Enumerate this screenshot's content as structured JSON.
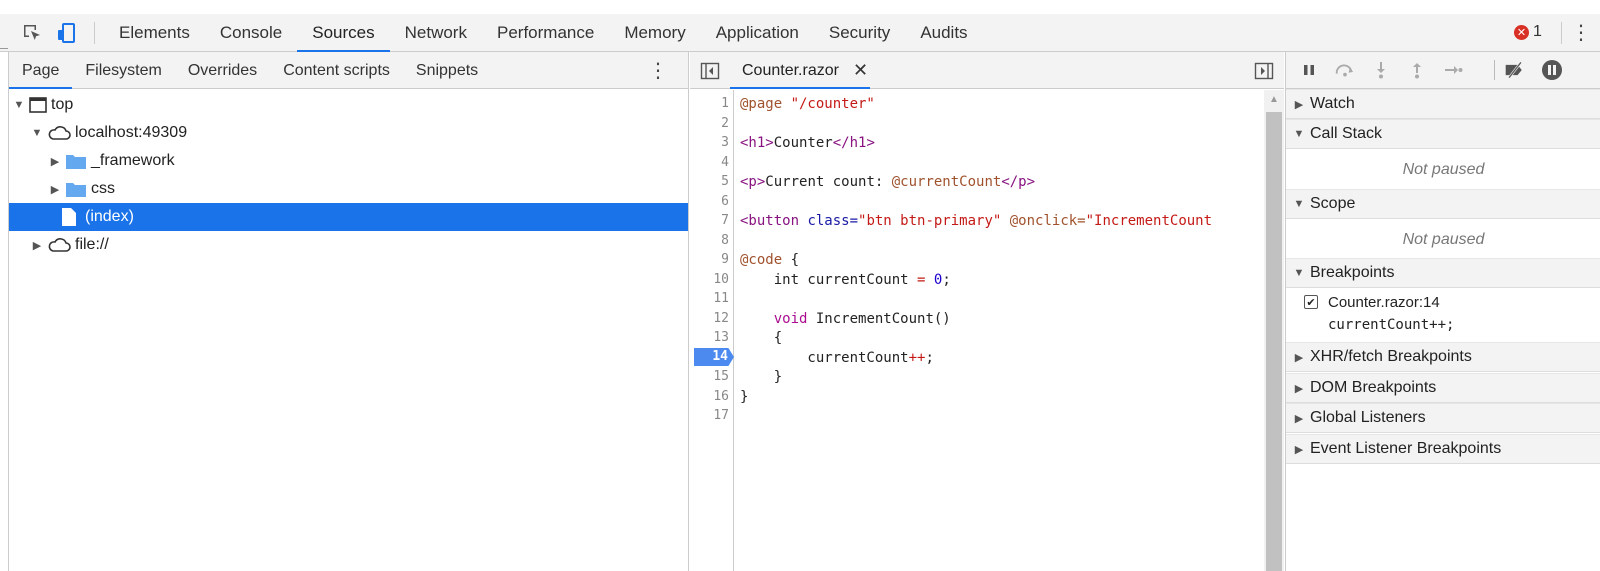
{
  "toolbar": {
    "tabs": [
      "Elements",
      "Console",
      "Sources",
      "Network",
      "Performance",
      "Memory",
      "Application",
      "Security",
      "Audits"
    ],
    "active_tab": "Sources",
    "error_count": "1"
  },
  "navigator": {
    "tabs": [
      "Page",
      "Filesystem",
      "Overrides",
      "Content scripts",
      "Snippets"
    ],
    "active_tab": "Page",
    "tree": [
      {
        "label": "top",
        "level": 0,
        "icon": "frame-icon",
        "expanded": true
      },
      {
        "label": "localhost:49309",
        "level": 1,
        "icon": "cloud-icon",
        "expanded": true
      },
      {
        "label": "_framework",
        "level": 2,
        "icon": "folder-icon",
        "expanded": false
      },
      {
        "label": "css",
        "level": 2,
        "icon": "folder-icon",
        "expanded": false
      },
      {
        "label": "(index)",
        "level": 2,
        "icon": "file-icon",
        "selected": true
      },
      {
        "label": "file://",
        "level": 1,
        "icon": "cloud-icon",
        "expanded": false
      }
    ]
  },
  "editor": {
    "file_tab": "Counter.razor",
    "breakpoint_line": "14",
    "lines": [
      "1",
      "2",
      "3",
      "4",
      "5",
      "6",
      "7",
      "8",
      "9",
      "10",
      "11",
      "12",
      "13",
      "14",
      "15",
      "16",
      "17"
    ],
    "code": {
      "l1_a": "@page ",
      "l1_b": "\"/counter\"",
      "l3_a": "<h1>",
      "l3_b": "Counter",
      "l3_c": "</h1>",
      "l5_a": "<p>",
      "l5_b": "Current count: ",
      "l5_c": "@currentCount",
      "l5_d": "</p>",
      "l7_a": "<button ",
      "l7_b": "class=",
      "l7_c": "\"btn btn-primary\"",
      "l7_d": " @onclick=",
      "l7_e": "\"IncrementCount",
      "l9_a": "@code",
      "l9_b": " {",
      "l10_a": "    int currentCount ",
      "l10_b": "=",
      "l10_c": " ",
      "l10_d": "0",
      "l10_e": ";",
      "l12_a": "    ",
      "l12_b": "void",
      "l12_c": " IncrementCount()",
      "l13": "    {",
      "l14_a": "        currentCount",
      "l14_b": "++",
      "l14_c": ";",
      "l15": "    }",
      "l16": "}"
    }
  },
  "debugger": {
    "sections": {
      "watch": "Watch",
      "call_stack": "Call Stack",
      "call_stack_status": "Not paused",
      "scope": "Scope",
      "scope_status": "Not paused",
      "breakpoints": "Breakpoints",
      "xhr": "XHR/fetch Breakpoints",
      "dom": "DOM Breakpoints",
      "global": "Global Listeners",
      "event": "Event Listener Breakpoints"
    },
    "breakpoint": {
      "location": "Counter.razor:14",
      "code": "currentCount++;"
    }
  }
}
